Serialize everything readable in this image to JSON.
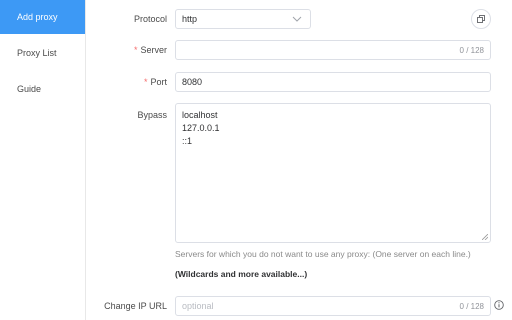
{
  "sidebar": {
    "items": [
      {
        "label": "Add proxy",
        "active": true
      },
      {
        "label": "Proxy List",
        "active": false
      },
      {
        "label": "Guide",
        "active": false
      }
    ]
  },
  "form": {
    "protocol": {
      "label": "Protocol",
      "value": "http"
    },
    "server": {
      "required_mark": "*",
      "label": "Server",
      "value": "",
      "count": "0 / 128"
    },
    "port": {
      "required_mark": "*",
      "label": "Port",
      "value": "8080"
    },
    "bypass": {
      "label": "Bypass",
      "lines": [
        "localhost",
        "127.0.0.1",
        "::1"
      ],
      "hint": "Servers for which you do not want to use any proxy: (One server on each line.)",
      "more_link": "(Wildcards and more available...)"
    },
    "change_ip": {
      "label": "Change IP URL",
      "placeholder": "optional",
      "count": "0 / 128"
    }
  },
  "icons": {
    "copy": "copy-icon",
    "chevron": "chevron-down-icon",
    "help": "info-icon"
  },
  "colors": {
    "accent": "#3d99f5",
    "required": "#f56c6c",
    "border": "#dcdfe6"
  }
}
